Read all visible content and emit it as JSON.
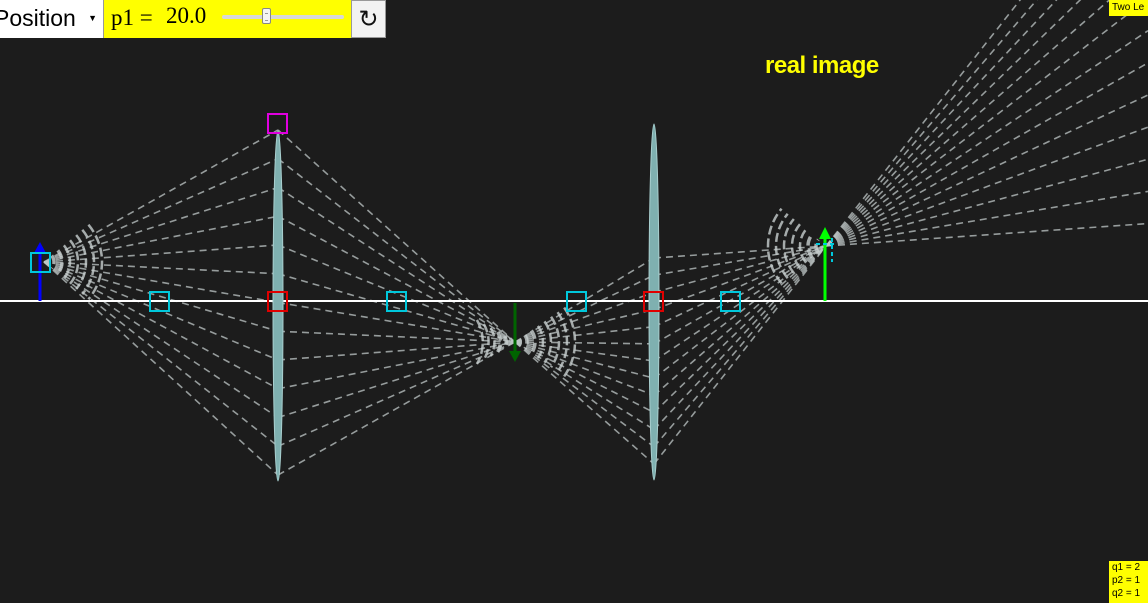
{
  "toolbar": {
    "mode_label": "Position",
    "param_label": "p1 =",
    "param_value": "20.0",
    "slider_fraction": 0.36,
    "reset_icon": "↻"
  },
  "corner_label": "Two Le",
  "image_type_label": "real image",
  "readout": {
    "q1": "q1 = 2",
    "p2": "p2 = 1",
    "q2": "q2 = 1"
  },
  "icons": {
    "reset": "reload-icon",
    "dropdown": "caret-down-icon"
  },
  "colors": {
    "background": "#1c1c1c",
    "panel_yellow": "#ffff00",
    "axis": "#ffffff",
    "rays": "#bfc7c7",
    "lens": "#7fb0b0",
    "object_arrow": "#0000ff",
    "intermediate_arrow": "#006400",
    "final_arrow": "#00ff00",
    "focal_marker": "#00c8dc",
    "center_marker": "#e00000",
    "handle_marker": "#e000e0"
  }
}
